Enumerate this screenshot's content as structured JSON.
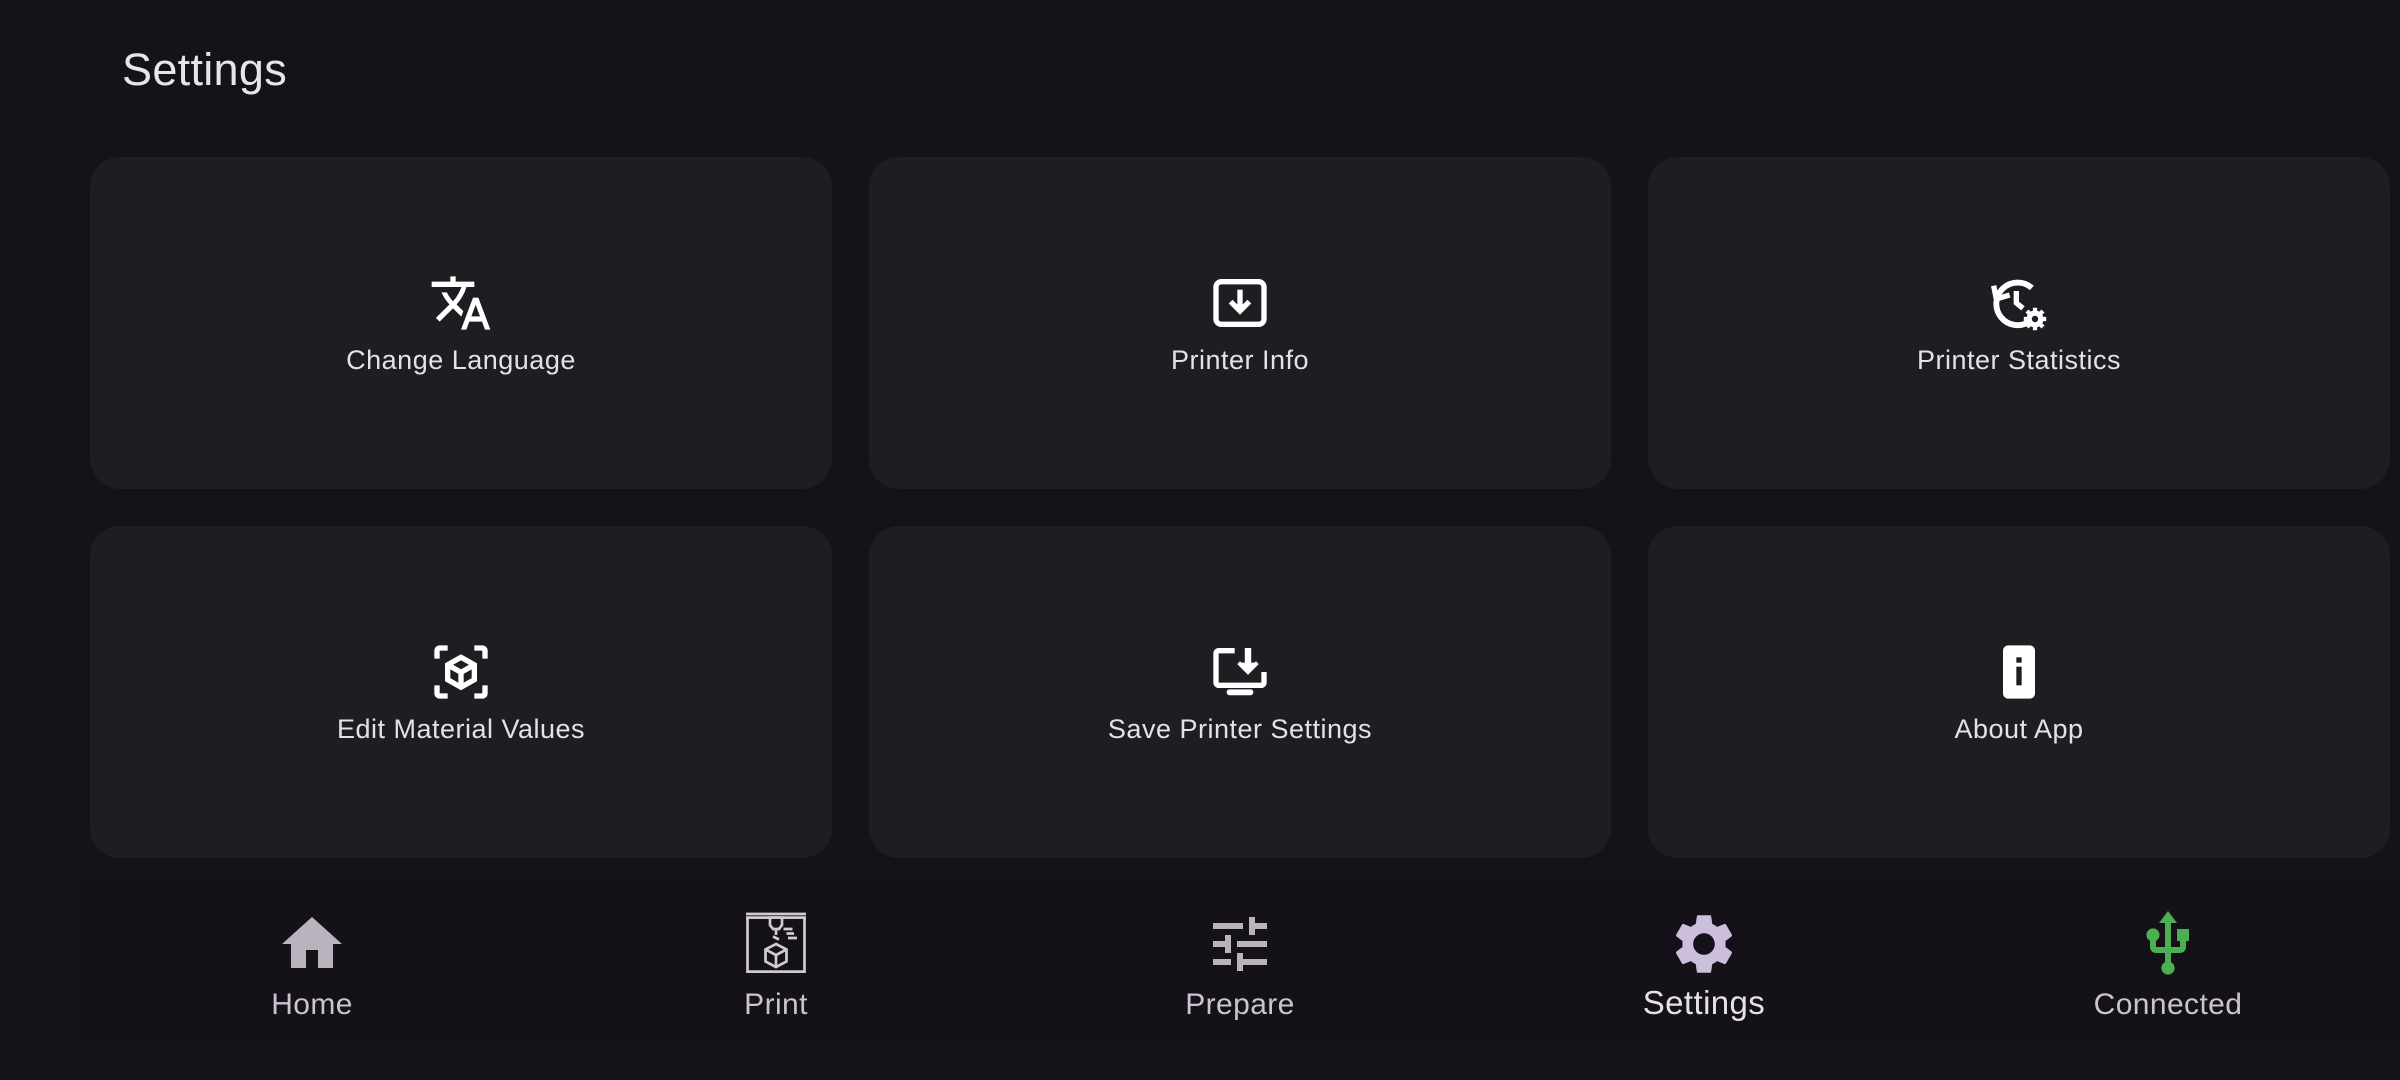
{
  "header": {
    "title": "Settings"
  },
  "cards": [
    {
      "label": "Change Language",
      "icon": "translate-icon"
    },
    {
      "label": "Printer Info",
      "icon": "download-box-icon"
    },
    {
      "label": "Printer Statistics",
      "icon": "history-gear-icon"
    },
    {
      "label": "Edit Material Values",
      "icon": "cube-scan-icon"
    },
    {
      "label": "Save Printer Settings",
      "icon": "monitor-download-icon"
    },
    {
      "label": "About App",
      "icon": "phone-info-icon"
    }
  ],
  "nav": {
    "items": [
      {
        "label": "Home",
        "icon": "home-icon"
      },
      {
        "label": "Print",
        "icon": "printer-3d-icon"
      },
      {
        "label": "Prepare",
        "icon": "tune-sliders-icon"
      },
      {
        "label": "Settings",
        "icon": "gear-icon",
        "active": true
      },
      {
        "label": "Connected",
        "icon": "usb-icon"
      }
    ]
  },
  "colors": {
    "background": "#15131a",
    "card": "#1e1d22",
    "active_nav_icon": "#cbbfdc",
    "nav_icon": "#b8b3bd",
    "connected": "#4caf50"
  }
}
